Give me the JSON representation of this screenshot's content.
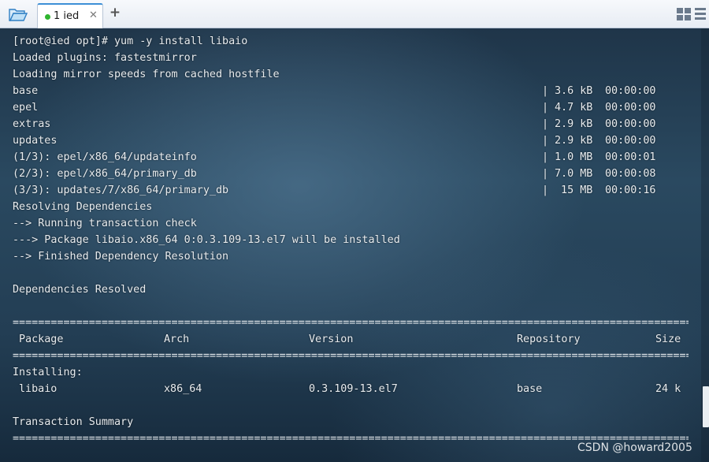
{
  "tabbar": {
    "tab_label": "1 ied",
    "close_glyph": "✕",
    "add_glyph": "+",
    "active_dot_color": "#2fb52f",
    "accent_color": "#3d8fd6"
  },
  "terminal": {
    "lines": [
      "[root@ied opt]# yum -y install libaio",
      "Loaded plugins: fastestmirror",
      "Loading mirror speeds from cached hostfile"
    ],
    "downloads": [
      {
        "name": "base",
        "bar": "|",
        "size": "3.6 kB",
        "time": "00:00:00"
      },
      {
        "name": "epel",
        "bar": "|",
        "size": "4.7 kB",
        "time": "00:00:00"
      },
      {
        "name": "extras",
        "bar": "|",
        "size": "2.9 kB",
        "time": "00:00:00"
      },
      {
        "name": "updates",
        "bar": "|",
        "size": "2.9 kB",
        "time": "00:00:00"
      },
      {
        "name": "(1/3): epel/x86_64/updateinfo",
        "bar": "|",
        "size": "1.0 MB",
        "time": "00:00:01"
      },
      {
        "name": "(2/3): epel/x86_64/primary_db",
        "bar": "|",
        "size": "7.0 MB",
        "time": "00:00:08"
      },
      {
        "name": "(3/3): updates/7/x86_64/primary_db",
        "bar": "|",
        "size": " 15 MB",
        "time": "00:00:16"
      }
    ],
    "resolving": [
      "Resolving Dependencies",
      "--> Running transaction check",
      "---> Package libaio.x86_64 0:0.3.109-13.el7 will be installed",
      "--> Finished Dependency Resolution"
    ],
    "deps_resolved": "Dependencies Resolved",
    "separator": "================================================================================================================================================",
    "table_headers": {
      "package": "Package",
      "arch": "Arch",
      "version": "Version",
      "repository": "Repository",
      "size": "Size"
    },
    "installing_label": "Installing:",
    "row": {
      "package": "libaio",
      "arch": "x86_64",
      "version": "0.3.109-13.el7",
      "repository": "base",
      "size": "24 k"
    },
    "summary_label": "Transaction Summary"
  },
  "watermark": "CSDN @howard2005"
}
